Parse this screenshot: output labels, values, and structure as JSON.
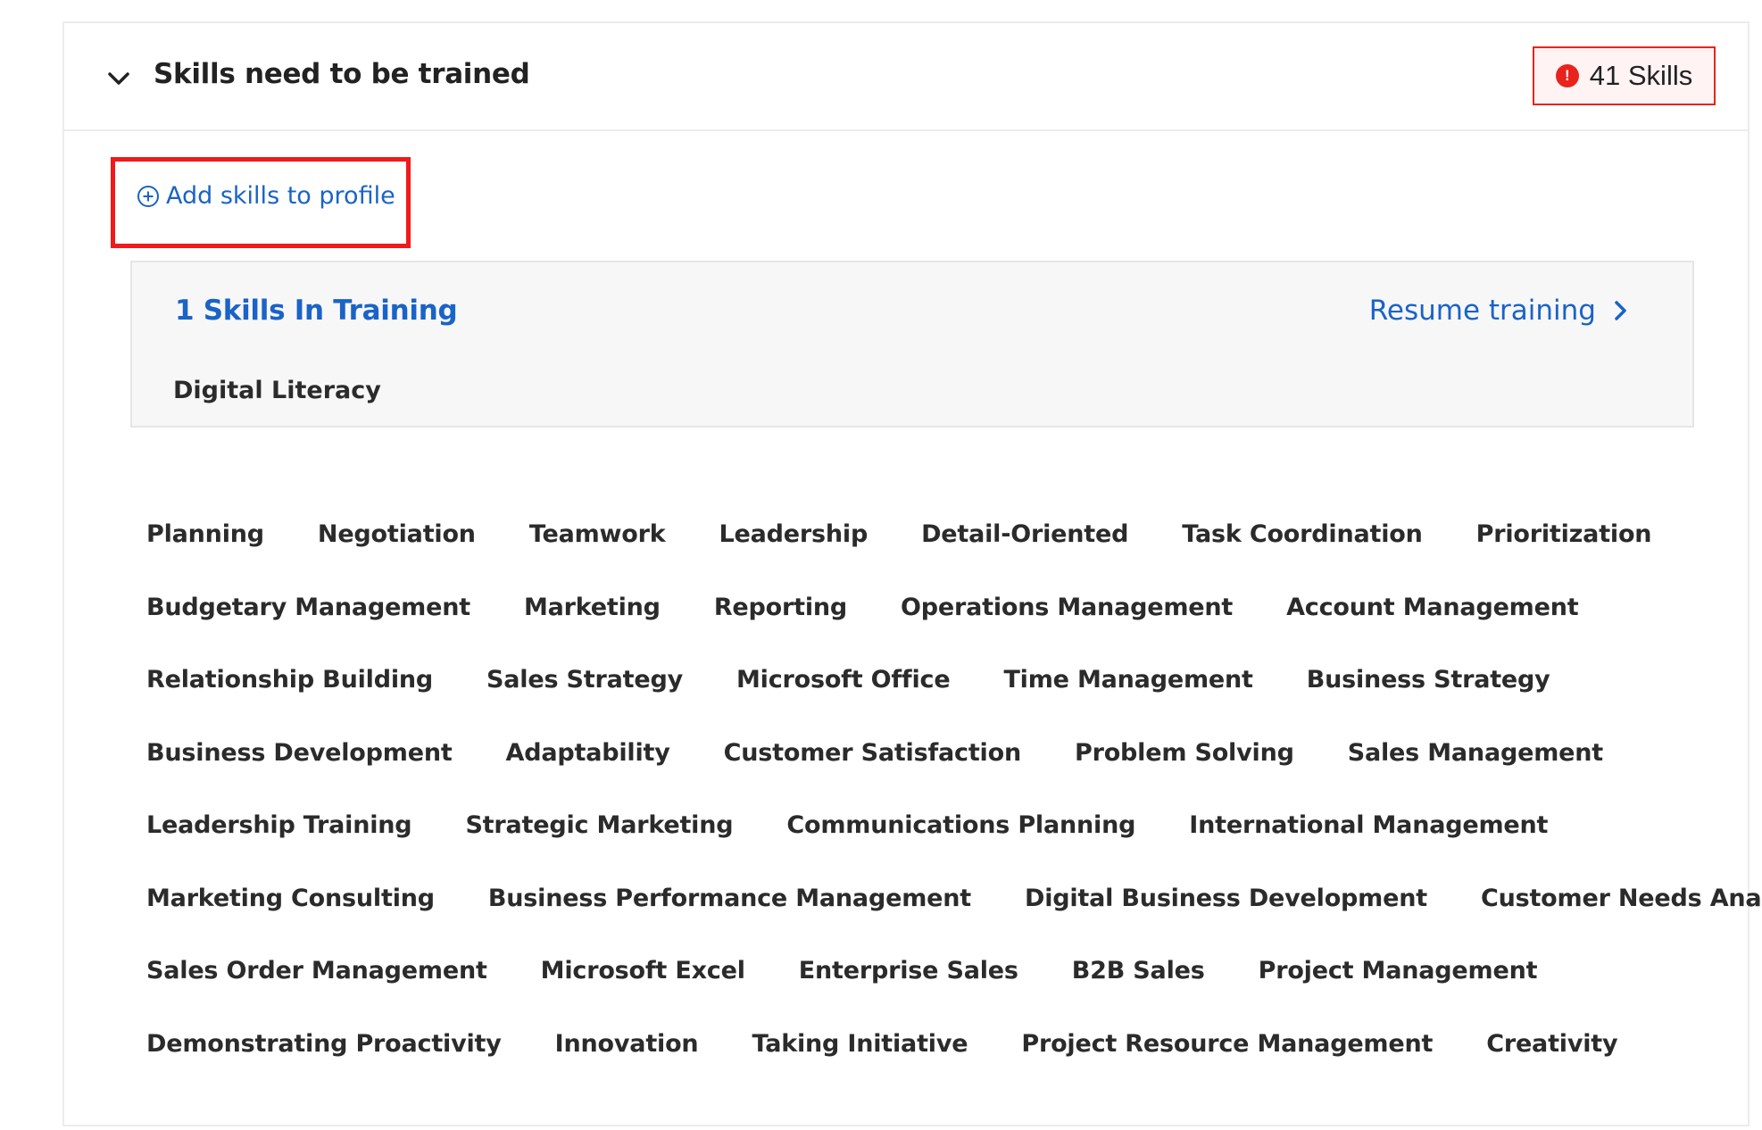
{
  "section": {
    "title": "Skills need to be trained",
    "badge": {
      "count_text": "41 Skills",
      "icon": "alert-circle-icon",
      "color": "#e8231d"
    },
    "add_skills_label": "Add skills to profile",
    "toggle_icon": "chevron-down-icon"
  },
  "training": {
    "title": "1 Skills In Training",
    "resume_label": "Resume training",
    "skill": "Digital Literacy"
  },
  "skills_rows": [
    [
      "Planning",
      "Negotiation",
      "Teamwork",
      "Leadership",
      "Detail-Oriented",
      "Task Coordination",
      "Prioritization"
    ],
    [
      "Budgetary Management",
      "Marketing",
      "Reporting",
      "Operations Management",
      "Account Management"
    ],
    [
      "Relationship Building",
      "Sales Strategy",
      "Microsoft Office",
      "Time Management",
      "Business Strategy"
    ],
    [
      "Business Development",
      "Adaptability",
      "Customer Satisfaction",
      "Problem Solving",
      "Sales Management"
    ],
    [
      "Leadership Training",
      "Strategic Marketing",
      "Communications Planning",
      "International Management"
    ],
    [
      "Marketing Consulting",
      "Business Performance Management",
      "Digital Business Development",
      "Customer Needs Analysis"
    ],
    [
      "Sales Order Management",
      "Microsoft Excel",
      "Enterprise Sales",
      "B2B Sales",
      "Project Management"
    ],
    [
      "Demonstrating Proactivity",
      "Innovation",
      "Taking Initiative",
      "Project Resource Management",
      "Creativity"
    ]
  ],
  "colors": {
    "link": "#1a63c7",
    "highlight": "#f01a1a",
    "text": "#2b2b2b"
  }
}
